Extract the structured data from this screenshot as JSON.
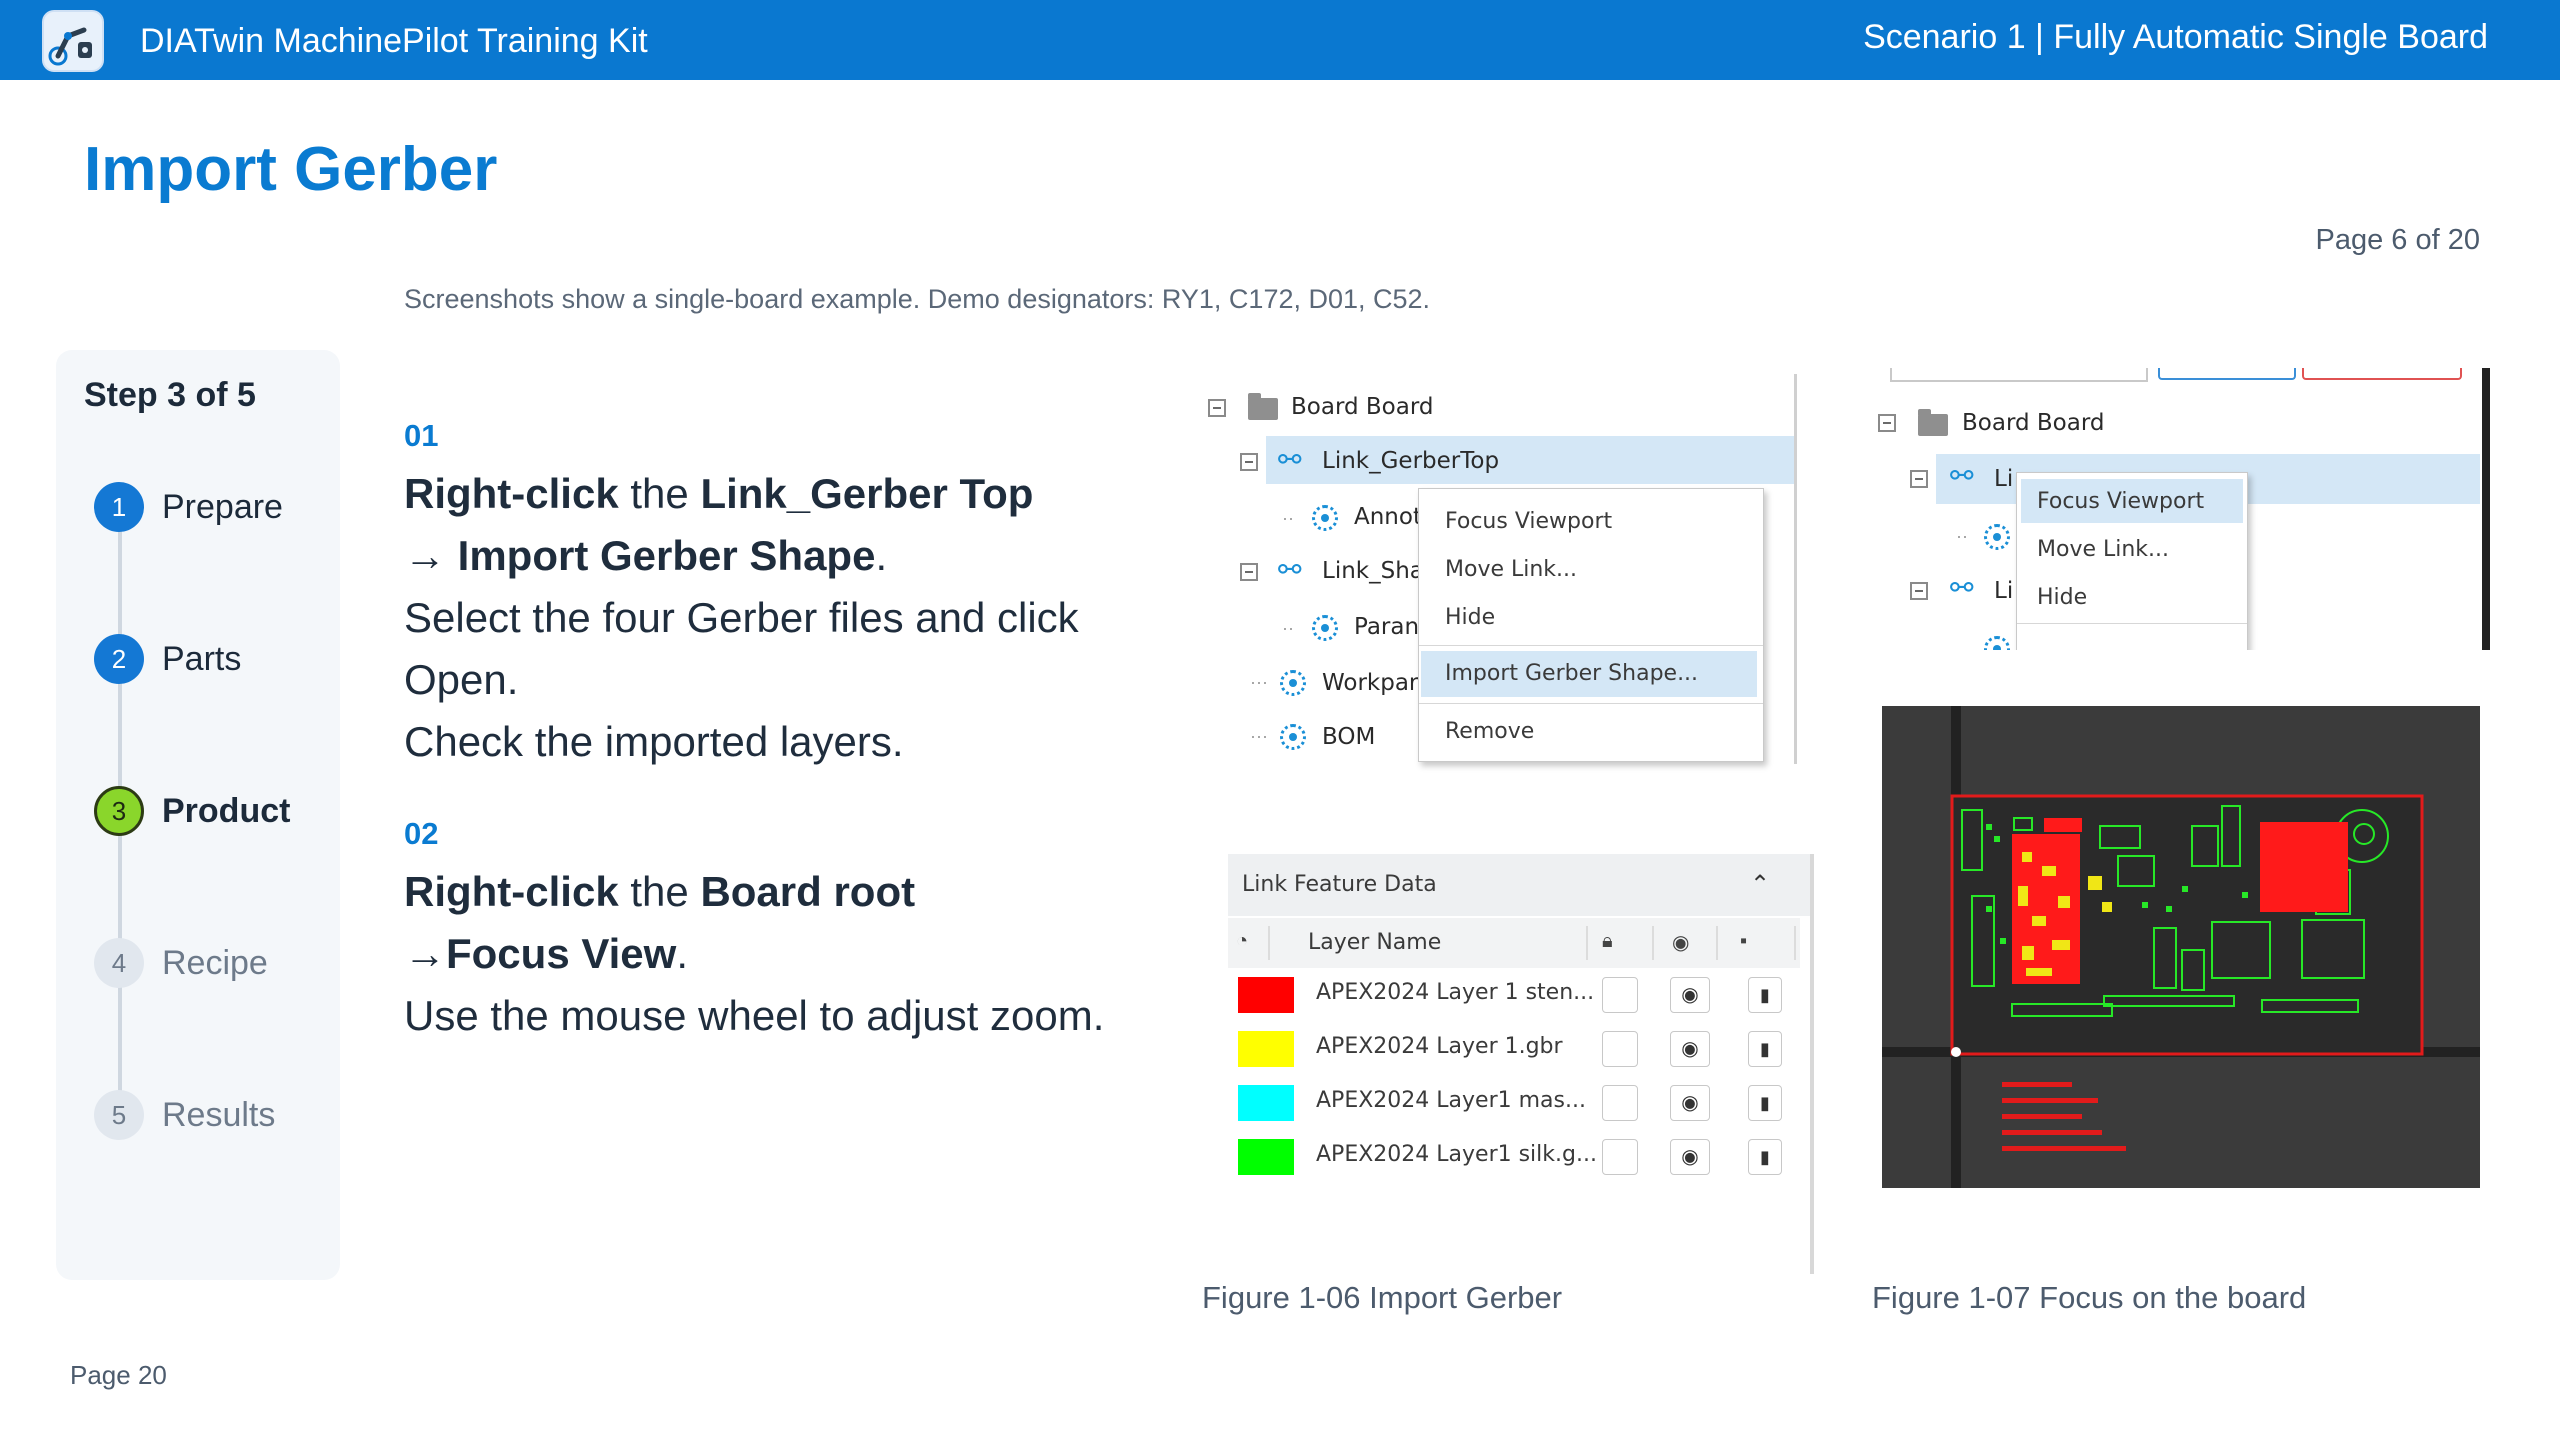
{
  "header": {
    "app_title": "DIATwin MachinePilot Training Kit",
    "scenario": "Scenario 1 | Fully Automatic Single Board",
    "logo_icon": "robot-arm-icon"
  },
  "page": {
    "title": "Import Gerber",
    "counter": "Page 6 of 20",
    "intro": "Screenshots show a single-board example. Demo designators: RY1, C172, D01, C52.",
    "footer": "Page 20"
  },
  "stepper": {
    "heading": "Step 3 of 5",
    "steps": [
      {
        "num": "1",
        "label": "Prepare",
        "state": "done"
      },
      {
        "num": "2",
        "label": "Parts",
        "state": "done"
      },
      {
        "num": "3",
        "label": "Product",
        "state": "active"
      },
      {
        "num": "4",
        "label": "Recipe",
        "state": "todo"
      },
      {
        "num": "5",
        "label": "Results",
        "state": "todo"
      }
    ]
  },
  "instructions": {
    "s1_num": "01",
    "s1_a1": "Right-click",
    "s1_a2": " the ",
    "s1_a3": "Link_Gerber Top",
    "s1_b1": "→ ",
    "s1_b2": "Import Gerber Shape",
    "s1_b3": ".",
    "s1_c": "Select the four Gerber files and click",
    "s1_d": "Open.",
    "s1_e": "Check the imported layers.",
    "s2_num": "02",
    "s2_a1": "Right-click",
    "s2_a2": " the ",
    "s2_a3": "Board root",
    "s2_b1": "→",
    "s2_b2": "Focus View",
    "s2_b3": ".",
    "s2_c": "Use the mouse wheel to adjust zoom."
  },
  "fig06": {
    "tree": {
      "board": "Board  Board",
      "link_top": "Link_GerberTop",
      "annot": "Annot",
      "link_sha": "Link_Sha",
      "param": "Paran",
      "workpart": "Workpart",
      "bom": "BOM"
    },
    "menu": [
      "Focus Viewport",
      "Move Link...",
      "Hide",
      "Import Gerber Shape...",
      "Remove"
    ],
    "caption": "Figure 1-06  Import Gerber"
  },
  "layer_table": {
    "title": "Link Feature Data",
    "col_layer": "Layer Name",
    "rows": [
      {
        "name": "APEX2024 Layer 1 sten...",
        "color": "#ff0000"
      },
      {
        "name": "APEX2024 Layer 1.gbr",
        "color": "#ffff00"
      },
      {
        "name": "APEX2024 Layer1 mas...",
        "color": "#00ffff"
      },
      {
        "name": "APEX2024 Layer1 silk.g...",
        "color": "#00ff00"
      }
    ]
  },
  "fig07": {
    "tree": {
      "board": "Board  Board",
      "li1": "Li",
      "li2": "Li"
    },
    "menu": [
      "Focus Viewport",
      "Move Link...",
      "Hide"
    ],
    "caption": "Figure 1-07  Focus on the board"
  },
  "colors": {
    "brand_blue": "#0a78d0",
    "heading_blue": "#0a7bd1",
    "active_step": "#8ad62b",
    "selection": "#d4e7f6"
  }
}
